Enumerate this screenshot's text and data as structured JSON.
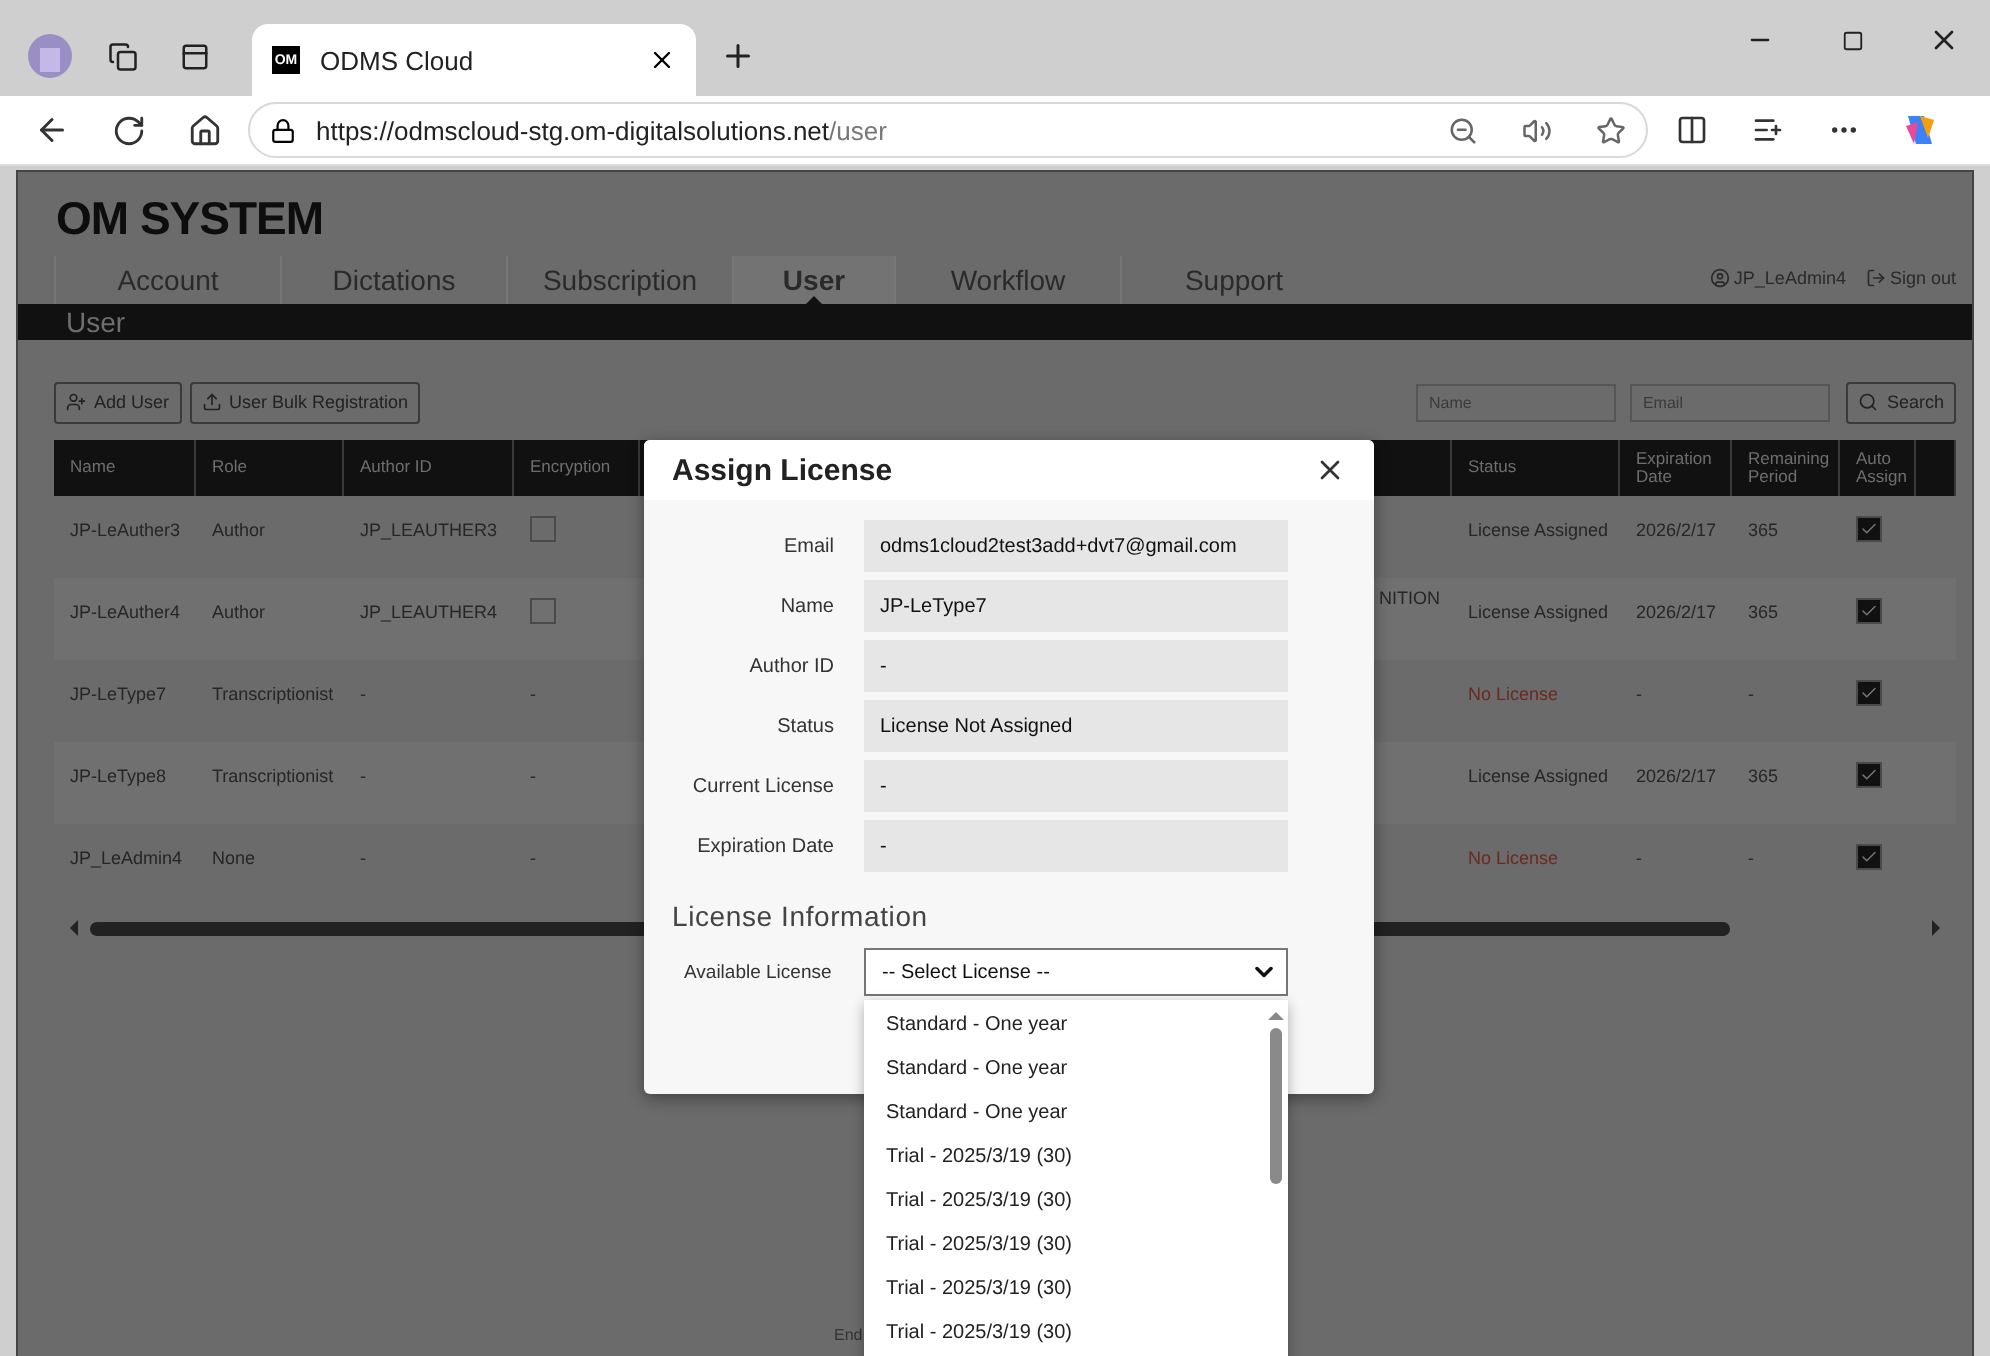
{
  "browser": {
    "tab": {
      "favicon_text": "OM",
      "title": "ODMS Cloud",
      "selected": true
    },
    "url": {
      "base": "https://odmscloud-stg.om-digitalsolutions.net",
      "path": "/user"
    }
  },
  "logo": "OM SYSTEM",
  "nav": [
    {
      "label": "Account",
      "selected": false
    },
    {
      "label": "Dictations",
      "selected": false
    },
    {
      "label": "Subscription",
      "selected": false
    },
    {
      "label": "User",
      "selected": true
    },
    {
      "label": "Workflow",
      "selected": false
    },
    {
      "label": "Support",
      "selected": false
    }
  ],
  "account": {
    "user": "JP_LeAdmin4",
    "sign_out": "Sign out"
  },
  "page_title": "User",
  "toolbar": {
    "buttons": [
      "Add User",
      "User Bulk Registration"
    ],
    "name_placeholder": "Name",
    "email_placeholder": "Email",
    "search": "Search"
  },
  "table": {
    "columns": [
      "Name",
      "Role",
      "Author ID",
      "Encryption",
      "Status",
      "Expiration Date",
      "Remaining Period",
      "Auto Assign"
    ],
    "rows": [
      {
        "name": "JP-LeAuther3",
        "role": "Author",
        "author_id": "JP_LEAUTHER3",
        "encryption": {
          "kind": "checkbox",
          "checked": false
        },
        "status": "License Assigned",
        "licensed": true,
        "expiration": "2026/2/17",
        "remaining": "365",
        "auto_assign": true
      },
      {
        "name": "JP-LeAuther4",
        "role": "Author",
        "author_id": "JP_LEAUTHER4",
        "encryption": {
          "kind": "checkbox",
          "checked": false
        },
        "column_6": "NITION",
        "status": "License Assigned",
        "licensed": true,
        "expiration": "2026/2/17",
        "remaining": "365",
        "auto_assign": true
      },
      {
        "name": "JP-LeType7",
        "role": "Transcriptionist",
        "author_id": "-",
        "encryption": {
          "kind": "text",
          "text": "-"
        },
        "status": "No License",
        "licensed": false,
        "expiration": "-",
        "remaining": "-",
        "auto_assign": true
      },
      {
        "name": "JP-LeType8",
        "role": "Transcriptionist",
        "author_id": "-",
        "encryption": {
          "kind": "text",
          "text": "-"
        },
        "status": "License Assigned",
        "licensed": true,
        "expiration": "2026/2/17",
        "remaining": "365",
        "auto_assign": true
      },
      {
        "name": "JP_LeAdmin4",
        "role": "None",
        "author_id": "-",
        "encryption": {
          "kind": "text",
          "text": "-"
        },
        "status": "No License",
        "licensed": false,
        "expiration": "-",
        "remaining": "-",
        "auto_assign": true
      }
    ]
  },
  "footer_text": "End",
  "dialog": {
    "title": "Assign License",
    "fields": [
      {
        "label": "Email",
        "value": "odms1cloud2test3add+dvt7@gmail.com"
      },
      {
        "label": "Name",
        "value": "JP-LeType7"
      },
      {
        "label": "Author ID",
        "value": "-"
      },
      {
        "label": "Status",
        "value": "License Not Assigned"
      },
      {
        "label": "Current License",
        "value": "-"
      },
      {
        "label": "Expiration Date",
        "value": "-"
      }
    ],
    "section": "License Information",
    "select_label": "Available License",
    "select_value": "-- Select License --",
    "options": [
      "Standard - One year",
      "Standard - One year",
      "Standard - One year",
      "Trial - 2025/3/19 (30)",
      "Trial - 2025/3/19 (30)",
      "Trial - 2025/3/19 (30)",
      "Trial - 2025/3/19 (30)",
      "Trial - 2025/3/19 (30)"
    ]
  }
}
